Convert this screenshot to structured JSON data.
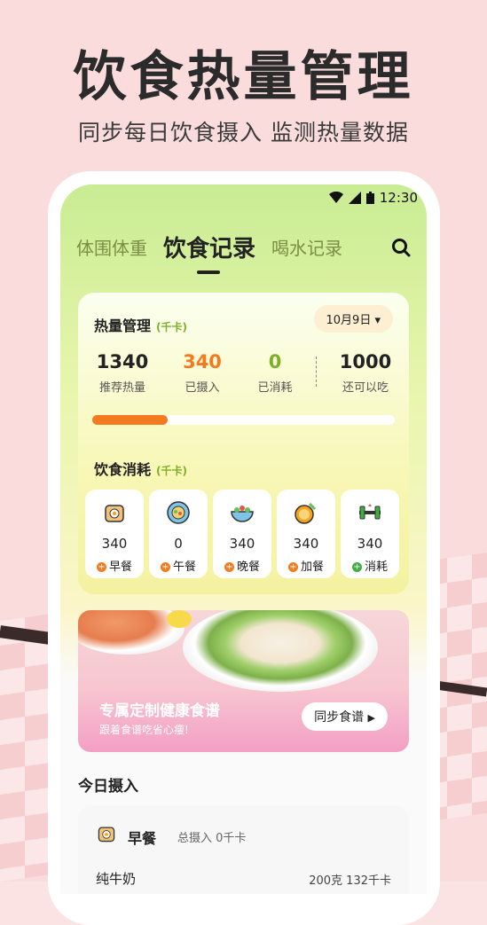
{
  "headline": "饮食热量管理",
  "subheadline": "同步每日饮食摄入 监测热量数据",
  "status": {
    "time": "12:30"
  },
  "tabs": [
    {
      "label": "体围体重"
    },
    {
      "label": "饮食记录"
    },
    {
      "label": "喝水记录"
    }
  ],
  "kcal_card": {
    "title": "热量管理",
    "unit": "(千卡)",
    "date": "10月9日",
    "stats": [
      {
        "value": "1340",
        "label": "推荐热量",
        "color": "#222222"
      },
      {
        "value": "340",
        "label": "已摄入",
        "color": "#f47a1f"
      },
      {
        "value": "0",
        "label": "已消耗",
        "color": "#7db028"
      },
      {
        "value": "1000",
        "label": "还可以吃",
        "color": "#222222"
      }
    ],
    "progress": 0.25
  },
  "consume": {
    "title": "饮食消耗",
    "unit": "(千卡)",
    "meals": [
      {
        "value": "340",
        "label": "早餐",
        "plus_color": "#f47a1f",
        "icon": "breakfast-icon"
      },
      {
        "value": "0",
        "label": "午餐",
        "plus_color": "#f47a1f",
        "icon": "lunch-icon"
      },
      {
        "value": "340",
        "label": "晚餐",
        "plus_color": "#f47a1f",
        "icon": "dinner-icon"
      },
      {
        "value": "340",
        "label": "加餐",
        "plus_color": "#f47a1f",
        "icon": "snack-icon"
      },
      {
        "value": "340",
        "label": "消耗",
        "plus_color": "#3fae3f",
        "icon": "exercise-icon"
      }
    ]
  },
  "banner": {
    "title": "专属定制健康食谱",
    "subtitle": "跟着食谱吃省心瘦!",
    "button": "同步食谱"
  },
  "today": {
    "title": "今日摄入"
  },
  "entry": {
    "meal": "早餐",
    "total": "总摄入 0千卡",
    "food": "纯牛奶",
    "amount": "200克 132千卡"
  }
}
